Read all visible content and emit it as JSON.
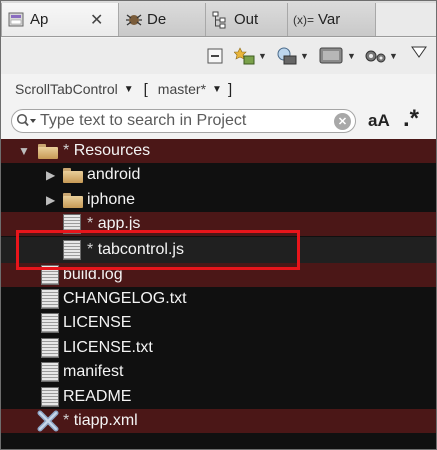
{
  "tabs": [
    {
      "label": "Ap",
      "icon": "app-explorer-icon",
      "active": true
    },
    {
      "label": "De",
      "icon": "debug-icon"
    },
    {
      "label": "Out",
      "icon": "outline-icon"
    },
    {
      "label": "Var",
      "icon": "variables-icon",
      "prefix": "(x)="
    }
  ],
  "project": {
    "name": "ScrollTabControl",
    "bracket_open": "[",
    "branch": "master*"
  },
  "search": {
    "placeholder": "Type text to search in Project",
    "case_label": "aA",
    "regex_label": ".*"
  },
  "tree": [
    {
      "name": "Resources",
      "star": "*",
      "type": "folder-open",
      "expanded": true,
      "modified": true
    },
    {
      "name": "android",
      "type": "folder",
      "expanded": false
    },
    {
      "name": "iphone",
      "type": "folder",
      "expanded": false
    },
    {
      "name": "app.js",
      "star": "*",
      "type": "file",
      "modified": true
    },
    {
      "name": "tabcontrol.js",
      "star": "*",
      "type": "file"
    },
    {
      "name": "build.log",
      "type": "file",
      "modified": true
    },
    {
      "name": "CHANGELOG.txt",
      "type": "file"
    },
    {
      "name": "LICENSE",
      "type": "file"
    },
    {
      "name": "LICENSE.txt",
      "type": "file"
    },
    {
      "name": "manifest",
      "type": "file"
    },
    {
      "name": "README",
      "type": "file"
    },
    {
      "name": "tiapp.xml",
      "star": "*",
      "type": "xml-file",
      "modified": true
    }
  ],
  "colors": {
    "highlight": "#e8151b",
    "modified_row": "#4b1717",
    "tree_bg": "#101010"
  }
}
